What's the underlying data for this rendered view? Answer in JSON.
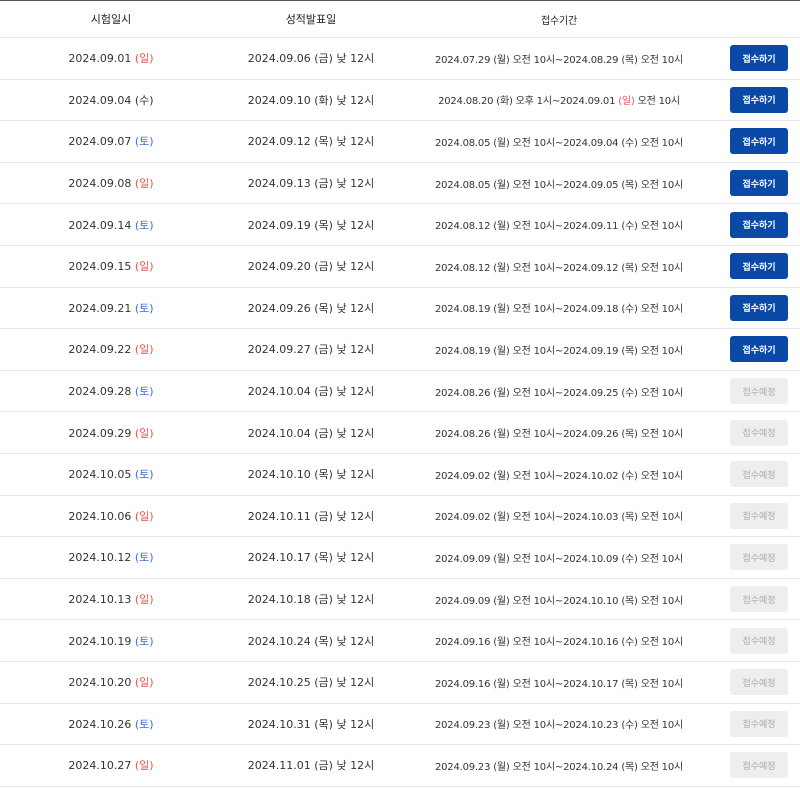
{
  "colors": {
    "sunday": "#e05555",
    "saturday": "#3d6fd1",
    "button_primary": "#0a4aa6",
    "button_disabled": "#eeeeee"
  },
  "header": {
    "col1": "시험일시",
    "col2": "성적발표일",
    "col3": "접수기간",
    "col4": ""
  },
  "rows": [
    {
      "date": "2024.09.01",
      "day": "(일)",
      "dayType": "sun",
      "result": "2024.09.06 (금) 낮 12시",
      "reg_start": "2024.07.29 (월) 오전 10시~2024.08.29 (목) 오전 10시",
      "reg_mid": "",
      "reg_end_day": "",
      "reg_end_time": "",
      "btn": "접수하기",
      "status": "open"
    },
    {
      "date": "2024.09.04",
      "day": "(수)",
      "dayType": "",
      "result": "2024.09.10 (화) 낮 12시",
      "reg_start": "2024.08.20 (화) 오후 1시~2024.09.01 ",
      "reg_mid": "(일)",
      "reg_end_day": " 오전 10시",
      "reg_end_time": "",
      "btn": "접수하기",
      "status": "open"
    },
    {
      "date": "2024.09.07",
      "day": "(토)",
      "dayType": "sat",
      "result": "2024.09.12 (목) 낮 12시",
      "reg_start": "2024.08.05 (월) 오전 10시~2024.09.04 (수) 오전 10시",
      "reg_mid": "",
      "reg_end_day": "",
      "reg_end_time": "",
      "btn": "접수하기",
      "status": "open"
    },
    {
      "date": "2024.09.08",
      "day": "(일)",
      "dayType": "sun",
      "result": "2024.09.13 (금) 낮 12시",
      "reg_start": "2024.08.05 (월) 오전 10시~2024.09.05 (목) 오전 10시",
      "reg_mid": "",
      "reg_end_day": "",
      "reg_end_time": "",
      "btn": "접수하기",
      "status": "open"
    },
    {
      "date": "2024.09.14",
      "day": "(토)",
      "dayType": "sat",
      "result": "2024.09.19 (목) 낮 12시",
      "reg_start": "2024.08.12 (월) 오전 10시~2024.09.11 (수) 오전 10시",
      "reg_mid": "",
      "reg_end_day": "",
      "reg_end_time": "",
      "btn": "접수하기",
      "status": "open"
    },
    {
      "date": "2024.09.15",
      "day": "(일)",
      "dayType": "sun",
      "result": "2024.09.20 (금) 낮 12시",
      "reg_start": "2024.08.12 (월) 오전 10시~2024.09.12 (목) 오전 10시",
      "reg_mid": "",
      "reg_end_day": "",
      "reg_end_time": "",
      "btn": "접수하기",
      "status": "open"
    },
    {
      "date": "2024.09.21",
      "day": "(토)",
      "dayType": "sat",
      "result": "2024.09.26 (목) 낮 12시",
      "reg_start": "2024.08.19 (월) 오전 10시~2024.09.18 (수) 오전 10시",
      "reg_mid": "",
      "reg_end_day": "",
      "reg_end_time": "",
      "btn": "접수하기",
      "status": "open"
    },
    {
      "date": "2024.09.22",
      "day": "(일)",
      "dayType": "sun",
      "result": "2024.09.27 (금) 낮 12시",
      "reg_start": "2024.08.19 (월) 오전 10시~2024.09.19 (목) 오전 10시",
      "reg_mid": "",
      "reg_end_day": "",
      "reg_end_time": "",
      "btn": "접수하기",
      "status": "open"
    },
    {
      "date": "2024.09.28",
      "day": "(토)",
      "dayType": "sat",
      "result": "2024.10.04 (금) 낮 12시",
      "reg_start": "2024.08.26 (월) 오전 10시~2024.09.25 (수) 오전 10시",
      "reg_mid": "",
      "reg_end_day": "",
      "reg_end_time": "",
      "btn": "접수예정",
      "status": "soon"
    },
    {
      "date": "2024.09.29",
      "day": "(일)",
      "dayType": "sun",
      "result": "2024.10.04 (금) 낮 12시",
      "reg_start": "2024.08.26 (월) 오전 10시~2024.09.26 (목) 오전 10시",
      "reg_mid": "",
      "reg_end_day": "",
      "reg_end_time": "",
      "btn": "접수예정",
      "status": "soon"
    },
    {
      "date": "2024.10.05",
      "day": "(토)",
      "dayType": "sat",
      "result": "2024.10.10 (목) 낮 12시",
      "reg_start": "2024.09.02 (월) 오전 10시~2024.10.02 (수) 오전 10시",
      "reg_mid": "",
      "reg_end_day": "",
      "reg_end_time": "",
      "btn": "접수예정",
      "status": "soon"
    },
    {
      "date": "2024.10.06",
      "day": "(일)",
      "dayType": "sun",
      "result": "2024.10.11 (금) 낮 12시",
      "reg_start": "2024.09.02 (월) 오전 10시~2024.10.03 (목) 오전 10시",
      "reg_mid": "",
      "reg_end_day": "",
      "reg_end_time": "",
      "btn": "접수예정",
      "status": "soon"
    },
    {
      "date": "2024.10.12",
      "day": "(토)",
      "dayType": "sat",
      "result": "2024.10.17 (목) 낮 12시",
      "reg_start": "2024.09.09 (월) 오전 10시~2024.10.09 (수) 오전 10시",
      "reg_mid": "",
      "reg_end_day": "",
      "reg_end_time": "",
      "btn": "접수예정",
      "status": "soon"
    },
    {
      "date": "2024.10.13",
      "day": "(일)",
      "dayType": "sun",
      "result": "2024.10.18 (금) 낮 12시",
      "reg_start": "2024.09.09 (월) 오전 10시~2024.10.10 (목) 오전 10시",
      "reg_mid": "",
      "reg_end_day": "",
      "reg_end_time": "",
      "btn": "접수예정",
      "status": "soon"
    },
    {
      "date": "2024.10.19",
      "day": "(토)",
      "dayType": "sat",
      "result": "2024.10.24 (목) 낮 12시",
      "reg_start": "2024.09.16 (월) 오전 10시~2024.10.16 (수) 오전 10시",
      "reg_mid": "",
      "reg_end_day": "",
      "reg_end_time": "",
      "btn": "접수예정",
      "status": "soon"
    },
    {
      "date": "2024.10.20",
      "day": "(일)",
      "dayType": "sun",
      "result": "2024.10.25 (금) 낮 12시",
      "reg_start": "2024.09.16 (월) 오전 10시~2024.10.17 (목) 오전 10시",
      "reg_mid": "",
      "reg_end_day": "",
      "reg_end_time": "",
      "btn": "접수예정",
      "status": "soon"
    },
    {
      "date": "2024.10.26",
      "day": "(토)",
      "dayType": "sat",
      "result": "2024.10.31 (목) 낮 12시",
      "reg_start": "2024.09.23 (월) 오전 10시~2024.10.23 (수) 오전 10시",
      "reg_mid": "",
      "reg_end_day": "",
      "reg_end_time": "",
      "btn": "접수예정",
      "status": "soon"
    },
    {
      "date": "2024.10.27",
      "day": "(일)",
      "dayType": "sun",
      "result": "2024.11.01 (금) 낮 12시",
      "reg_start": "2024.09.23 (월) 오전 10시~2024.10.24 (목) 오전 10시",
      "reg_mid": "",
      "reg_end_day": "",
      "reg_end_time": "",
      "btn": "접수예정",
      "status": "soon"
    }
  ]
}
